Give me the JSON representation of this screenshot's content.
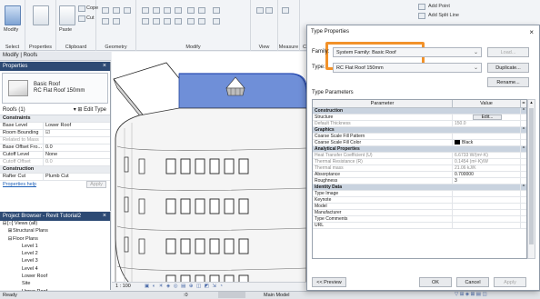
{
  "ribbon": {
    "select_label": "Select",
    "properties_label": "Properties",
    "clipboard_label": "Clipboard",
    "geometry_label": "Geometry",
    "modify_label": "Modify",
    "view_label": "View",
    "measure_label": "Measure",
    "create_label": "Creat",
    "modify_button": "Modify",
    "paste_button": "Paste",
    "cope_label": "Cope",
    "cut_label": "Cut",
    "add_point": "Add Point",
    "add_split_line": "Add Split Line"
  },
  "context": {
    "label": "Modify | Roofs"
  },
  "properties": {
    "title": "Properties",
    "type_name_line1": "Basic Roof",
    "type_name_line2": "RC Flat Roof 150mm",
    "instance_label": "Roofs (1)",
    "edit_type": "Edit Type",
    "constraints": "Constraints",
    "rows": [
      {
        "k": "Base Level",
        "v": "Lower Roof"
      },
      {
        "k": "Room Bounding",
        "v": "☑"
      },
      {
        "k": "Related to Mass",
        "v": ""
      },
      {
        "k": "Base Offset Fro...",
        "v": "0.0"
      },
      {
        "k": "Cutoff Level",
        "v": "None"
      },
      {
        "k": "Cutoff Offset",
        "v": "0.0"
      }
    ],
    "construction": "Construction",
    "rafter_row": {
      "k": "Rafter Cut",
      "v": "Plumb Cut"
    },
    "help_link": "Properties help",
    "apply": "Apply"
  },
  "browser": {
    "title": "Project Browser - Revit Tutorial2",
    "items": [
      {
        "toggle": "⊟",
        "label": "[○] Views (all)",
        "indent": 2
      },
      {
        "toggle": "⊞",
        "label": "Structural Plans",
        "indent": 8
      },
      {
        "toggle": "⊟",
        "label": "Floor Plans",
        "indent": 8
      },
      {
        "toggle": "",
        "label": "Level 1",
        "indent": 18
      },
      {
        "toggle": "",
        "label": "Level 2",
        "indent": 18
      },
      {
        "toggle": "",
        "label": "Level 3",
        "indent": 18
      },
      {
        "toggle": "",
        "label": "Level 4",
        "indent": 18
      },
      {
        "toggle": "",
        "label": "Lower Roof",
        "indent": 18
      },
      {
        "toggle": "",
        "label": "Site",
        "indent": 18
      },
      {
        "toggle": "",
        "label": "Upper Roof",
        "indent": 18
      }
    ]
  },
  "viewbar": {
    "scale": "1 : 100"
  },
  "status": {
    "ready": "Ready",
    "zero": ":0",
    "model": "Main Model"
  },
  "dialog": {
    "title": "Type Properties",
    "family_label": "Family:",
    "family_value": "System Family: Basic Roof",
    "type_label": "Type:",
    "type_value": "RC Flat Roof 150mm",
    "load_btn": "Load...",
    "duplicate_btn": "Duplicate...",
    "rename_btn": "Rename...",
    "type_parameters": "Type Parameters",
    "col_param": "Parameter",
    "col_value": "Value",
    "edit_btn": "Edit...",
    "preview_btn": "<< Preview",
    "ok_btn": "OK",
    "cancel_btn": "Cancel",
    "apply_btn": "Apply",
    "rows": [
      {
        "kind": "grp",
        "p": "Construction"
      },
      {
        "kind": "row",
        "p": "Structure",
        "v": "",
        "btn": true
      },
      {
        "kind": "dis",
        "p": "Default Thickness",
        "v": "150.0"
      },
      {
        "kind": "grp",
        "p": "Graphics"
      },
      {
        "kind": "row",
        "p": "Coarse Scale Fill Pattern",
        "v": ""
      },
      {
        "kind": "row",
        "p": "Coarse Scale Fill Color",
        "v": "Black",
        "swatch": true
      },
      {
        "kind": "grp",
        "p": "Analytical Properties"
      },
      {
        "kind": "dis",
        "p": "Heat Transfer Coefficient (U)",
        "v": "6.6733 W/(m²·K)"
      },
      {
        "kind": "dis",
        "p": "Thermal Resistance (R)",
        "v": "0.1454 (m²·K)/W"
      },
      {
        "kind": "dis",
        "p": "Thermal mass",
        "v": "21.06 kJ/K"
      },
      {
        "kind": "row",
        "p": "Absorptance",
        "v": "0.700000"
      },
      {
        "kind": "row",
        "p": "Roughness",
        "v": "3"
      },
      {
        "kind": "grp",
        "p": "Identity Data"
      },
      {
        "kind": "row",
        "p": "Type Image",
        "v": ""
      },
      {
        "kind": "row",
        "p": "Keynote",
        "v": ""
      },
      {
        "kind": "row",
        "p": "Model",
        "v": ""
      },
      {
        "kind": "row",
        "p": "Manufacturer",
        "v": ""
      },
      {
        "kind": "row",
        "p": "Type Comments",
        "v": ""
      },
      {
        "kind": "row",
        "p": "URL",
        "v": ""
      }
    ]
  },
  "colors": {
    "highlight": "#f2922a",
    "selection": "#6f8fd8",
    "panel_header": "#2d4a74"
  }
}
